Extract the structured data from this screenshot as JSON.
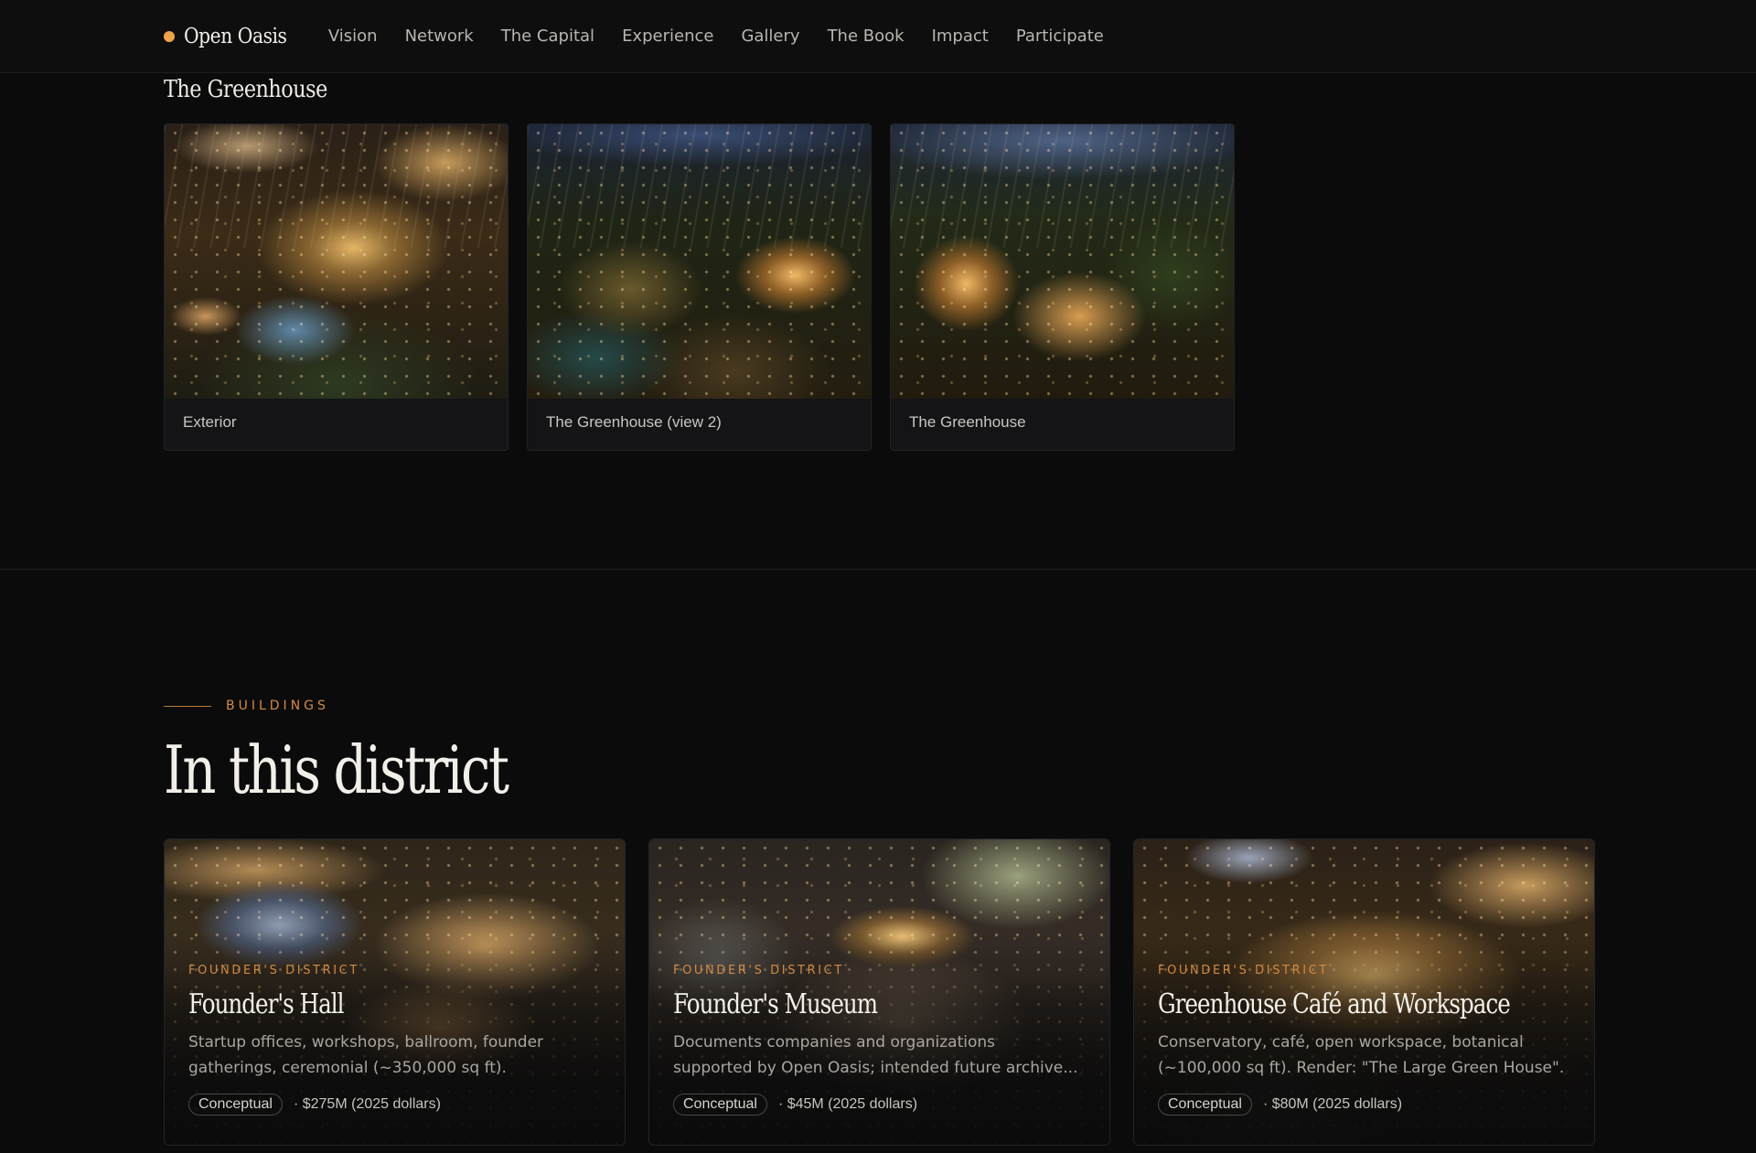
{
  "nav": {
    "brand": "Open Oasis",
    "links": [
      "Vision",
      "Network",
      "The Capital",
      "Experience",
      "Gallery",
      "The Book",
      "Impact",
      "Participate"
    ]
  },
  "gallery": {
    "title": "The Greenhouse",
    "cards": [
      {
        "caption": "Exterior"
      },
      {
        "caption": "The Greenhouse (view 2)"
      },
      {
        "caption": "The Greenhouse"
      }
    ]
  },
  "buildings": {
    "eyebrow": "BUILDINGS",
    "title": "In this district",
    "cards": [
      {
        "district": "FOUNDER'S DISTRICT",
        "name": "Founder's Hall",
        "desc_line1": "Startup offices, workshops, ballroom, founder",
        "desc_line2": "gatherings, ceremonial (~350,000 sq ft).",
        "status": "Conceptual",
        "cost": "· $275M (2025 dollars)"
      },
      {
        "district": "FOUNDER'S DISTRICT",
        "name": "Founder's Museum",
        "desc_line1": "Documents companies and organizations",
        "desc_line2": "supported by Open Oasis; intended future archive...",
        "status": "Conceptual",
        "cost": "· $45M (2025 dollars)"
      },
      {
        "district": "FOUNDER'S DISTRICT",
        "name": "Greenhouse Café and Workspace",
        "desc_line1": "Conservatory, café, open workspace, botanical",
        "desc_line2": "(~100,000 sq ft). Render: \"The Large Green House\".",
        "status": "Conceptual",
        "cost": "· $80M (2025 dollars)"
      }
    ]
  },
  "colors": {
    "accent": "#f0a34a",
    "eyebrow": "#d58a45",
    "background": "#0b0b0c"
  }
}
